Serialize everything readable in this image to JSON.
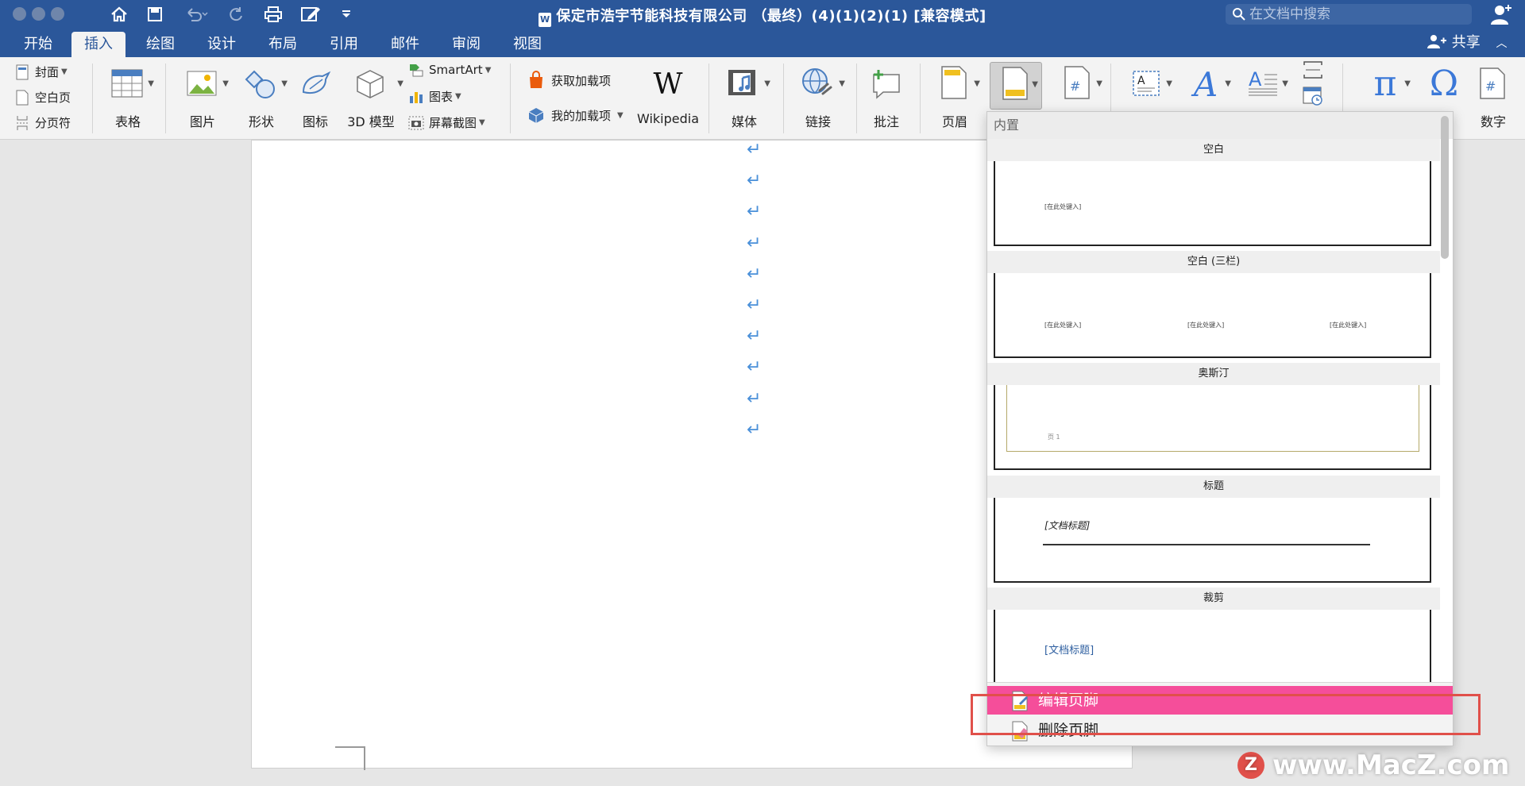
{
  "window": {
    "title": "保定市浩宇节能科技有限公司 （最终）(4)(1)(2)(1) [兼容模式]",
    "search_placeholder": "在文档中搜索",
    "share_label": "共享"
  },
  "tabs": [
    "开始",
    "插入",
    "绘图",
    "设计",
    "布局",
    "引用",
    "邮件",
    "审阅",
    "视图"
  ],
  "ribbon": {
    "pages": [
      "封面",
      "空白页",
      "分页符"
    ],
    "table": "表格",
    "picture": "图片",
    "shapes": "形状",
    "icons": "图标",
    "model3d": "3D 模型",
    "smartart": "SmartArt",
    "chart": "图表",
    "screenshot": "屏幕截图",
    "get_addins": "获取加载项",
    "my_addins": "我的加载项",
    "wikipedia": "Wikipedia",
    "media": "媒体",
    "link": "链接",
    "comment": "批注",
    "header": "页眉",
    "number": "数字"
  },
  "footer_menu": {
    "section_header": "内置",
    "items": [
      {
        "title": "空白",
        "placeholders": [
          "[在此处键入]"
        ]
      },
      {
        "title": "空白 (三栏)",
        "placeholders": [
          "[在此处键入]",
          "[在此处键入]",
          "[在此处键入]"
        ]
      },
      {
        "title": "奥斯汀",
        "placeholders": [
          "页 1"
        ]
      },
      {
        "title": "标题",
        "placeholders": [
          "[文档标题]"
        ]
      },
      {
        "title": "裁剪",
        "placeholders": [
          "[文档标题]"
        ]
      }
    ],
    "edit_footer": "编辑页脚",
    "remove_footer": "删除页脚"
  },
  "watermark": "www.MacZ.com",
  "colors": {
    "brand": "#2b579a",
    "highlight": "#f54e9a",
    "callout": "#e0504a",
    "paragraph_mark": "#4a90d9"
  }
}
